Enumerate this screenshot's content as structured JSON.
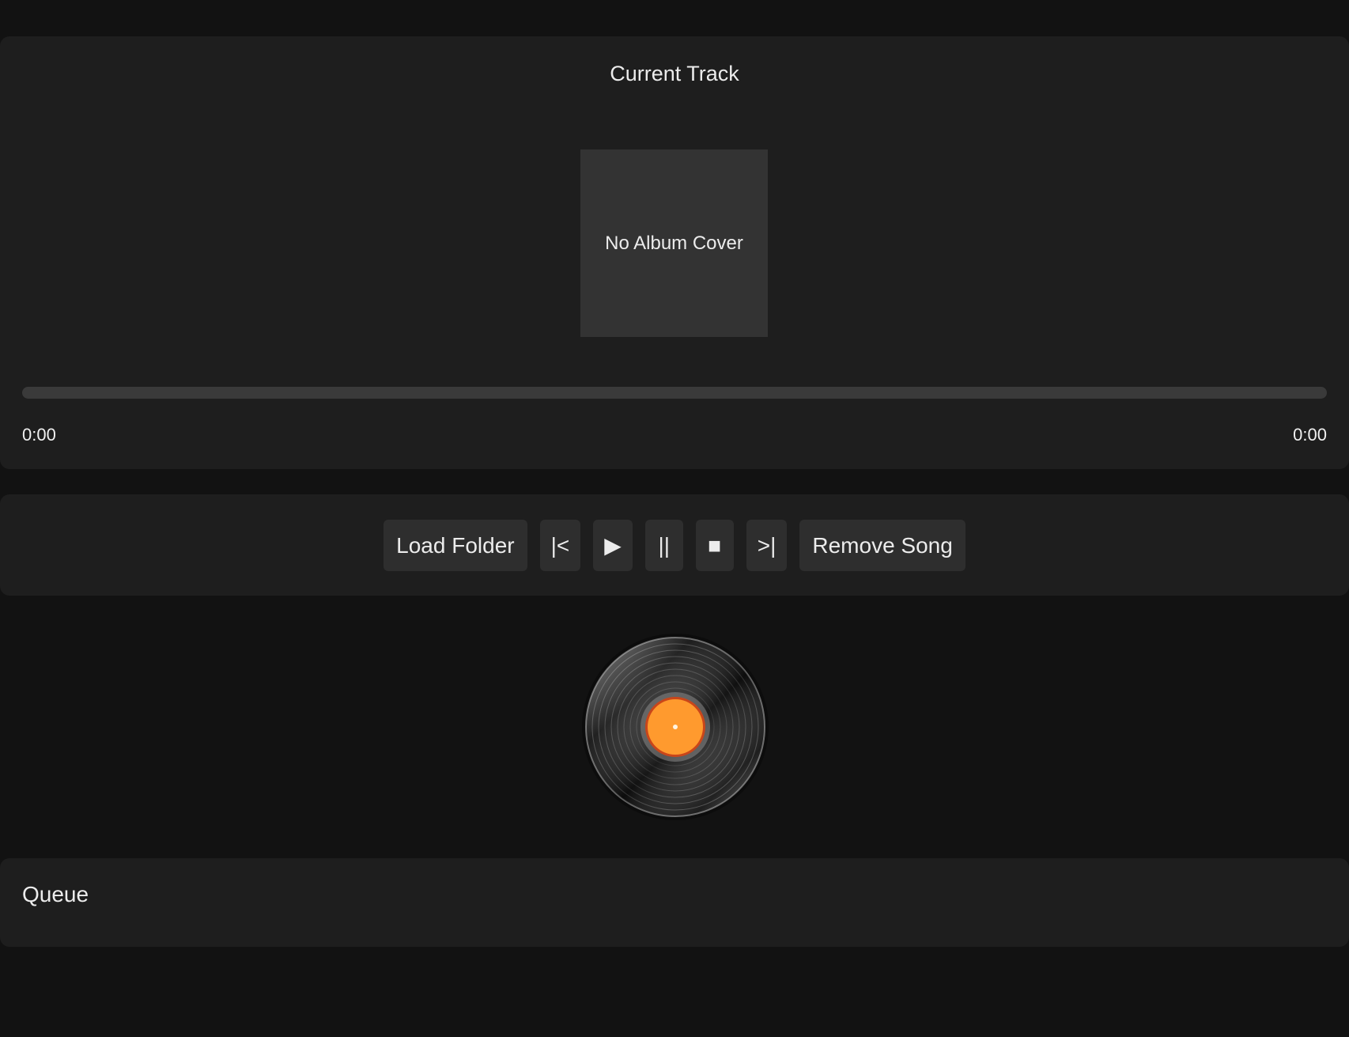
{
  "track": {
    "section_title": "Current Track",
    "album_cover_placeholder": "No Album Cover",
    "progress_fraction": 0,
    "time_current": "0:00",
    "time_total": "0:00"
  },
  "controls": {
    "load_folder": "Load Folder",
    "previous": "|<",
    "play": "▶",
    "pause": "||",
    "stop": "■",
    "next": ">|",
    "remove_song": "Remove Song"
  },
  "queue": {
    "title": "Queue",
    "items": []
  },
  "colors": {
    "background": "#121212",
    "panel": "#1e1e1e",
    "button": "#2e2e2e",
    "record_label": "#ff9a2e"
  },
  "icons": {
    "vinyl": "vinyl-record-icon"
  }
}
